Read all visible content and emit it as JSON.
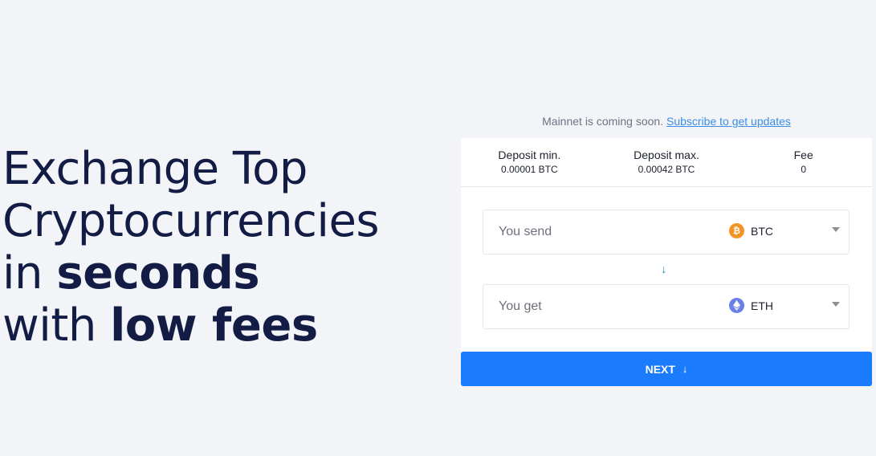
{
  "hero": {
    "line1": "Exchange Top",
    "line2": "Cryptocurrencies",
    "line3_prefix": "in ",
    "line3_bold": "seconds",
    "line4_prefix": "with ",
    "line4_bold": "low fees"
  },
  "notice": {
    "text": "Mainnet is coming soon.",
    "link": "Subscribe to get updates"
  },
  "stats": [
    {
      "label": "Deposit min.",
      "value": "0.00001 BTC"
    },
    {
      "label": "Deposit max.",
      "value": "0.00042 BTC"
    },
    {
      "label": "Fee",
      "value": "0"
    }
  ],
  "send": {
    "placeholder": "You send",
    "currency": "BTC",
    "icon": "bitcoin-icon",
    "color": "#f49325"
  },
  "get": {
    "placeholder": "You get",
    "currency": "ETH",
    "icon": "ethereum-icon",
    "color": "#6c7fe7"
  },
  "swap_icon": "arrow-down-icon",
  "next": {
    "label": "NEXT",
    "icon": "arrow-down-icon"
  },
  "colors": {
    "accent": "#1a7cfd",
    "heading": "#131c44",
    "link": "#3a8ee6",
    "background": "#f3f4f8"
  }
}
